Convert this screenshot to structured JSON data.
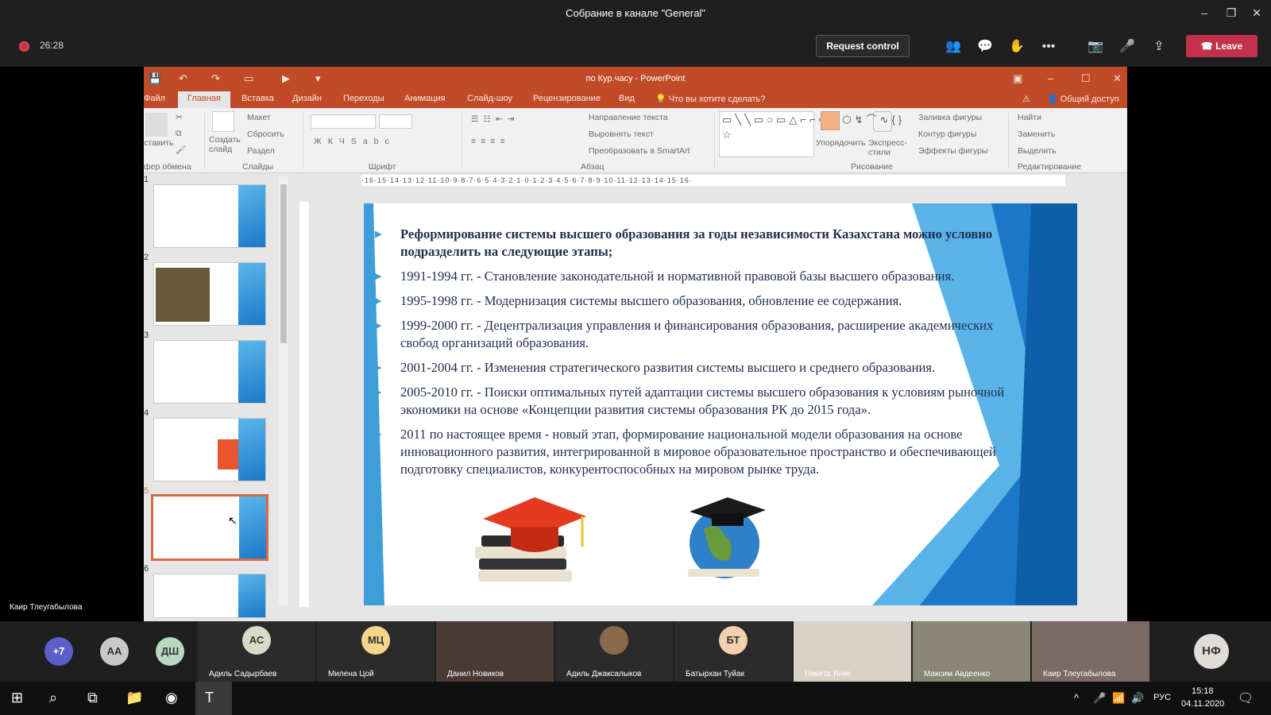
{
  "window": {
    "title": "Собрание в канале \"General\""
  },
  "call": {
    "timer": "26:28",
    "request_control": "Request control",
    "leave": "Leave",
    "speaker_name": "Каир Тлеугабылова"
  },
  "ppt": {
    "title": "по Кур.часу - PowerPoint",
    "tabs": [
      "Файл",
      "Главная",
      "Вставка",
      "Дизайн",
      "Переходы",
      "Анимация",
      "Слайд-шоу",
      "Рецензирование",
      "Вид"
    ],
    "tell_me": "Что вы хотите сделать?",
    "share": "Общий доступ",
    "ribbon": {
      "paste": "ставить",
      "new_slide": "Создать слайд",
      "layout": "Макет",
      "reset": "Сбросить",
      "section": "Раздел",
      "text_direction": "Направление текста",
      "align_text": "Выровнять текст",
      "convert_smartart": "Преобразовать в SmartArt",
      "arrange": "Упорядочить",
      "quick_styles": "Экспресс-стили",
      "shape_fill": "Заливка фигуры",
      "shape_outline": "Контур фигуры",
      "shape_effects": "Эффекты фигуры",
      "find": "Найти",
      "replace": "Заменить",
      "select": "Выделить",
      "groups": {
        "clipboard": "фер обмена",
        "slides": "Слайды",
        "font": "Шрифт",
        "paragraph": "Абзац",
        "drawing": "Рисование",
        "editing": "Редактирование"
      }
    },
    "ruler": "·16·15·14·13·12·11·10·9·8·7·6·5·4·3·2·1·0·1·2·3·4·5·6·7·8·9·10·11·12·13·14·15·16·",
    "thumb_numbers": [
      "1",
      "2",
      "3",
      "4",
      "5",
      "6"
    ],
    "slide": {
      "bullets": [
        "Реформирование системы высшего образования за годы независимости Казахстана можно условно подразделить на следующие этапы;",
        "1991-1994 гг. - Становление законодательной и нормативной правовой базы высшего образования.",
        "1995-1998 гг. - Модернизация системы высшего образования, обновление ее содержания.",
        "1999-2000 гг. - Децентрализация управления и финансирования образования, расширение академических свобод организаций образования.",
        "2001-2004 гг. - Изменения стратегического развития системы высшего и среднего образования.",
        "2005-2010 гг. - Поиски оптимальных путей адаптации системы высшего образования к условиям рыночной экономики на основе «Концепции развития системы образования РК до 2015 года».",
        "2011 по настоящее время - новый этап, формирование национальной модели образования на основе инновационного развития, интегрированной в мировое образовательное пространство и обеспечивающей подготовку специалистов, конкурентоспособных на мировом рынке труда."
      ]
    }
  },
  "participants": {
    "more": "+7",
    "avatars": [
      "АА",
      "ДШ",
      "АС",
      "МЦ",
      "БТ",
      "НФ"
    ],
    "names": [
      "Адиль Садырбаев",
      "Милена Цой",
      "Данил Новиков",
      "Адиль Джаксалыков",
      "Батырхан Туйак",
      "Никита Янке",
      "Максим Авдеенко",
      "Каир Тлеугабылова"
    ]
  },
  "taskbar": {
    "lang": "РУС",
    "time": "15:18",
    "date": "04.11.2020"
  },
  "colors": {
    "ppt_accent": "#c14b28",
    "leave": "#c4314b",
    "slide_blue": "#1b78c8"
  }
}
